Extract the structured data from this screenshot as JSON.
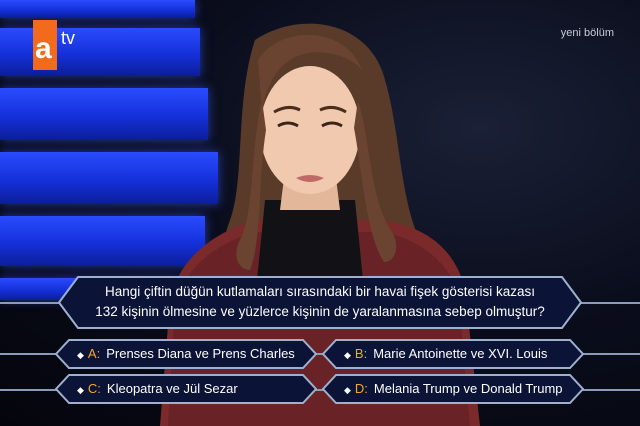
{
  "logo": {
    "letter": "a",
    "suffix": "tv",
    "color": "#f26a1c"
  },
  "badge": {
    "text": "yeni bölüm"
  },
  "question": {
    "line1": "Hangi çiftin düğün kutlamaları sırasındaki bir havai fişek gösterisi kazası",
    "line2": "132 kişinin ölmesine ve yüzlerce kişinin de yaralanmasına sebep olmuştur?"
  },
  "answers": [
    {
      "letter": "A:",
      "text": "Prenses Diana ve Prens Charles"
    },
    {
      "letter": "B:",
      "text": "Marie Antoinette ve XVI. Louis"
    },
    {
      "letter": "C:",
      "text": "Kleopatra ve Jül Sezar"
    },
    {
      "letter": "D:",
      "text": "Melania Trump ve Donald Trump"
    }
  ],
  "colors": {
    "panel": "#0b1436",
    "border": "#9fb0cf",
    "letter": "#f5a623",
    "stage_blue": "#2a4cff"
  }
}
